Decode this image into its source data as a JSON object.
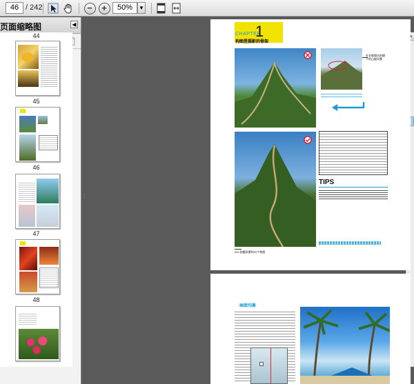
{
  "toolbar": {
    "current_page": "46",
    "total_pages": "/ 242",
    "zoom": "50%",
    "zoom_dropdown_icon": "chevron-down-icon"
  },
  "panel": {
    "title": "页面缩略图",
    "thumbnails": [
      {
        "label": "44"
      },
      {
        "label": "45"
      },
      {
        "label": "46"
      },
      {
        "label": "47"
      },
      {
        "label": "48"
      }
    ]
  },
  "page1": {
    "chapter_word": "CHAPTER",
    "chapter_number": "1",
    "section_title": "构图是摄影的骨架",
    "annotation": "在长焦镜头拍摄\n下的山坡风景",
    "tips_heading": "TIPS",
    "footer": "044  拍摄风景的20个构图",
    "colors": {
      "chapter_yellow": "#f2e200",
      "accent_cyan": "#1a9ad6"
    }
  },
  "page2": {
    "heading": "画面均衡"
  }
}
